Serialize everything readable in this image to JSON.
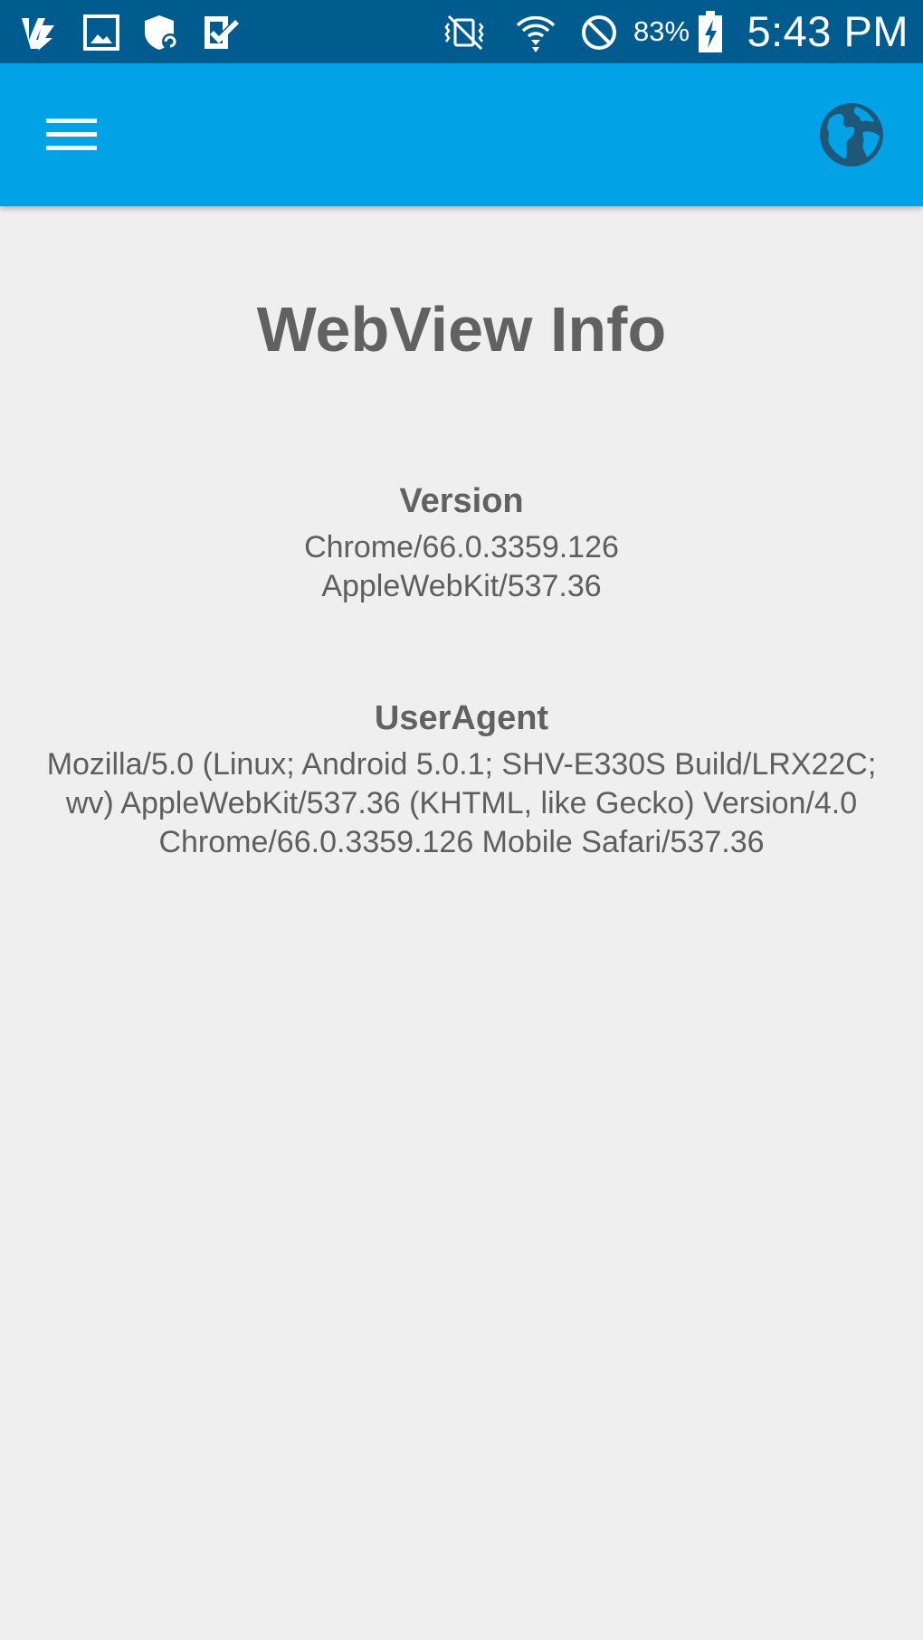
{
  "status_bar": {
    "battery_percent": "83%",
    "time": "5:43 PM",
    "icons": [
      "app-notification-icon",
      "image-icon",
      "shield-sync-icon",
      "check-box-icon",
      "vibrate-icon",
      "wifi-icon",
      "do-not-disturb-icon",
      "battery-charging-icon"
    ]
  },
  "app_bar": {
    "menu_icon": "hamburger-menu-icon",
    "action_icon": "globe-icon",
    "color": "#02a3e6"
  },
  "page": {
    "title": "WebView Info",
    "version": {
      "label": "Version",
      "lines": [
        "Chrome/66.0.3359.126",
        "AppleWebKit/537.36"
      ]
    },
    "user_agent": {
      "label": "UserAgent",
      "lines": [
        "Mozilla/5.0 (Linux; Android 5.0.1; SHV-E330S Build/LRX22C;",
        "wv) AppleWebKit/537.36 (KHTML, like Gecko) Version/4.0",
        "Chrome/66.0.3359.126 Mobile Safari/537.36"
      ]
    }
  }
}
